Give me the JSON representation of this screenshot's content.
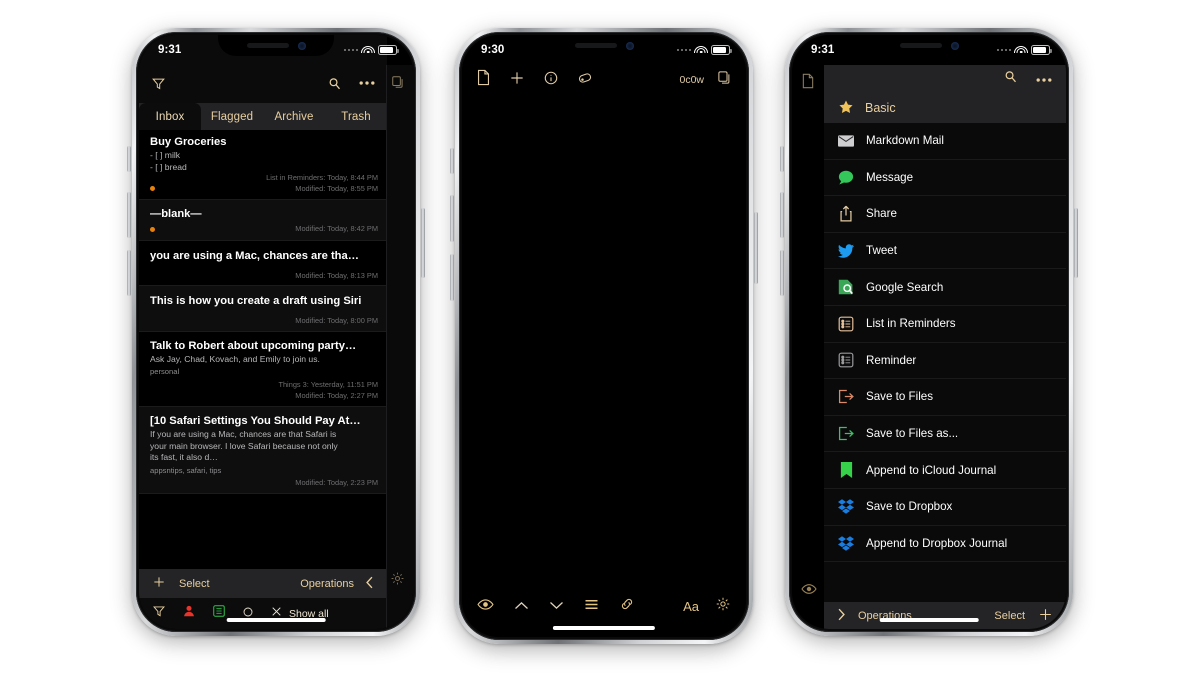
{
  "scene": {
    "background_color": "#ffffff",
    "phone_count": 3,
    "device": "iPhone X",
    "app_theme": "dark",
    "accent_color": "#e8cfa0"
  },
  "phone1": {
    "status": {
      "time": "9:31",
      "wifi": "wifi-icon",
      "battery": "battery-icon",
      "signal": "signal-dots"
    },
    "navbar": {
      "filter_icon": "filter-funnel-icon",
      "search_icon": "search-magnifier-icon",
      "more_icon": "more-ellipsis-icon",
      "copy_icon": "duplicate-document-icon"
    },
    "tabs": [
      {
        "label": "Inbox",
        "selected": true
      },
      {
        "label": "Flagged",
        "selected": false
      },
      {
        "label": "Archive",
        "selected": false
      },
      {
        "label": "Trash",
        "selected": false
      }
    ],
    "rows": [
      {
        "title": "Buy Groceries",
        "body": [
          "- [ ] milk",
          "- [ ] bread"
        ],
        "tags": "",
        "meta": [
          "List in Reminders: Today, 8:44 PM",
          "Modified: Today, 8:55 PM"
        ],
        "dot": true
      },
      {
        "title": "—blank—",
        "body": [],
        "tags": "",
        "meta": [
          "Modified: Today, 8:42 PM"
        ],
        "dot": true
      },
      {
        "title": "you are using a Mac, chances are tha…",
        "body": [],
        "tags": "",
        "meta": [
          "Modified: Today, 8:13 PM"
        ],
        "dot": false
      },
      {
        "title": "This is how you create a draft using Siri",
        "body": [],
        "tags": "",
        "meta": [
          "Modified: Today, 8:00 PM"
        ],
        "dot": false
      },
      {
        "title": "Talk to Robert about upcoming party…",
        "body": [
          "Ask Jay, Chad, Kovach, and Emily to join us."
        ],
        "tags": "personal",
        "meta": [
          "Things 3: Yesterday, 11:51 PM",
          "Modified: Today, 2:27 PM"
        ],
        "dot": false
      },
      {
        "title": "[10 Safari Settings You Should Pay At…",
        "body": [
          "If you are using a Mac, chances are that Safari is",
          "your main browser. I love Safari because not only",
          "its fast, it also d…"
        ],
        "tags": "appsntips, safari, tips",
        "meta": [
          "Modified: Today, 2:23 PM"
        ],
        "dot": false
      }
    ],
    "ops_bar": {
      "plus_icon": "plus-icon",
      "select_label": "Select",
      "operations_label": "Operations",
      "chevron_icon": "chevron-left-icon"
    },
    "toolbar": {
      "items": [
        {
          "icon": "filter-funnel-icon",
          "label": ""
        },
        {
          "icon": "person-red-icon",
          "label": ""
        },
        {
          "icon": "list-green-icon",
          "label": ""
        },
        {
          "icon": "circle-outline-icon",
          "label": ""
        },
        {
          "icon": "close-x-icon",
          "label": "Show all"
        }
      ],
      "gear_icon": "gear-icon"
    }
  },
  "phone2": {
    "status": {
      "time": "9:30",
      "wifi": "wifi-icon",
      "battery": "battery-icon",
      "signal": "signal-dots"
    },
    "topbar": {
      "document_icon": "document-page-icon",
      "plus_icon": "plus-icon",
      "info_icon": "info-circle-icon",
      "tag_icon": "tag-label-icon",
      "counter": "0c0w",
      "copy_icon": "duplicate-document-icon"
    },
    "editor": {
      "content": "",
      "placeholder": ""
    },
    "bottombar": {
      "preview_icon": "eye-icon",
      "up_icon": "chevron-up-icon",
      "down_icon": "chevron-down-icon",
      "lines_icon": "list-lines-icon",
      "link_icon": "link-chain-icon",
      "text_label": "Aa",
      "gear_icon": "gear-icon"
    }
  },
  "phone3": {
    "status": {
      "time": "9:31",
      "wifi": "wifi-icon",
      "battery": "battery-icon",
      "signal": "signal-dots"
    },
    "underlay": {
      "document_icon": "document-page-icon",
      "preview_icon": "eye-icon"
    },
    "sheet_nav": {
      "search_icon": "search-magnifier-icon",
      "more_icon": "more-ellipsis-icon"
    },
    "section_header": {
      "icon": "star-icon",
      "label": "Basic"
    },
    "menu_items": [
      {
        "label": "Markdown Mail",
        "icon": "mail-envelope-icon",
        "color": "#d6d6d6"
      },
      {
        "label": "Message",
        "icon": "message-bubble-icon",
        "color": "#34c759"
      },
      {
        "label": "Share",
        "icon": "share-up-icon",
        "color": "#e8cfa0"
      },
      {
        "label": "Tweet",
        "icon": "twitter-bird-icon",
        "color": "#1d9bf0"
      },
      {
        "label": "Google Search",
        "icon": "google-search-icon",
        "color": "#34a853"
      },
      {
        "label": "List in Reminders",
        "icon": "reminders-list-icon",
        "color": "#e3bf9a"
      },
      {
        "label": "Reminder",
        "icon": "reminder-list-icon",
        "color": "#9a9a9c"
      },
      {
        "label": "Save to Files",
        "icon": "save-export-icon",
        "color": "#d88a6a"
      },
      {
        "label": "Save to Files as...",
        "icon": "save-export-icon",
        "color": "#3ec06a"
      },
      {
        "label": "Append to iCloud Journal",
        "icon": "journal-book-icon",
        "color": "#35d24a"
      },
      {
        "label": "Save to Dropbox",
        "icon": "dropbox-icon",
        "color": "#1a7ee0"
      },
      {
        "label": "Append to Dropbox Journal",
        "icon": "dropbox-icon",
        "color": "#1a7ee0"
      }
    ],
    "bottombar": {
      "chevron_icon": "chevron-right-icon",
      "operations_label": "Operations",
      "select_label": "Select",
      "plus_icon": "plus-icon"
    }
  }
}
